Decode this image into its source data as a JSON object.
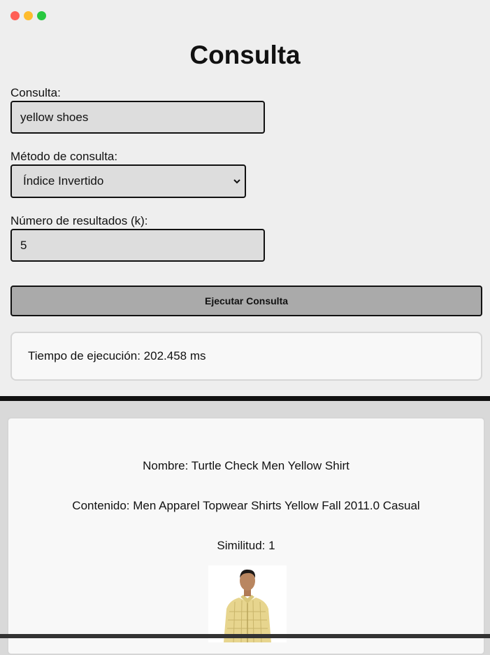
{
  "window": {
    "controls": [
      {
        "name": "close",
        "color": "#ff5f57"
      },
      {
        "name": "minimize",
        "color": "#febc2e"
      },
      {
        "name": "maximize",
        "color": "#28c840"
      }
    ]
  },
  "form": {
    "title": "Consulta",
    "query": {
      "label": "Consulta:",
      "value": "yellow shoes"
    },
    "method": {
      "label": "Método de consulta:",
      "selected": "Índice Invertido"
    },
    "k": {
      "label": "Número de resultados (k):",
      "value": "5"
    },
    "submit_label": "Ejecutar Consulta"
  },
  "timing": {
    "text": "Tiempo de ejecución: 202.458 ms"
  },
  "results": [
    {
      "name": "Nombre: Turtle Check Men Yellow Shirt",
      "content": "Contenido: Men Apparel Topwear Shirts Yellow Fall 2011.0 Casual",
      "similarity": "Similitud: 1",
      "image_icon": "product-photo-man-yellow-check-shirt"
    }
  ],
  "colors": {
    "panel_bg": "#eeeeee",
    "field_bg": "#dddddd",
    "button_bg": "#aaaaaa",
    "shirt": "#e7d58e"
  }
}
